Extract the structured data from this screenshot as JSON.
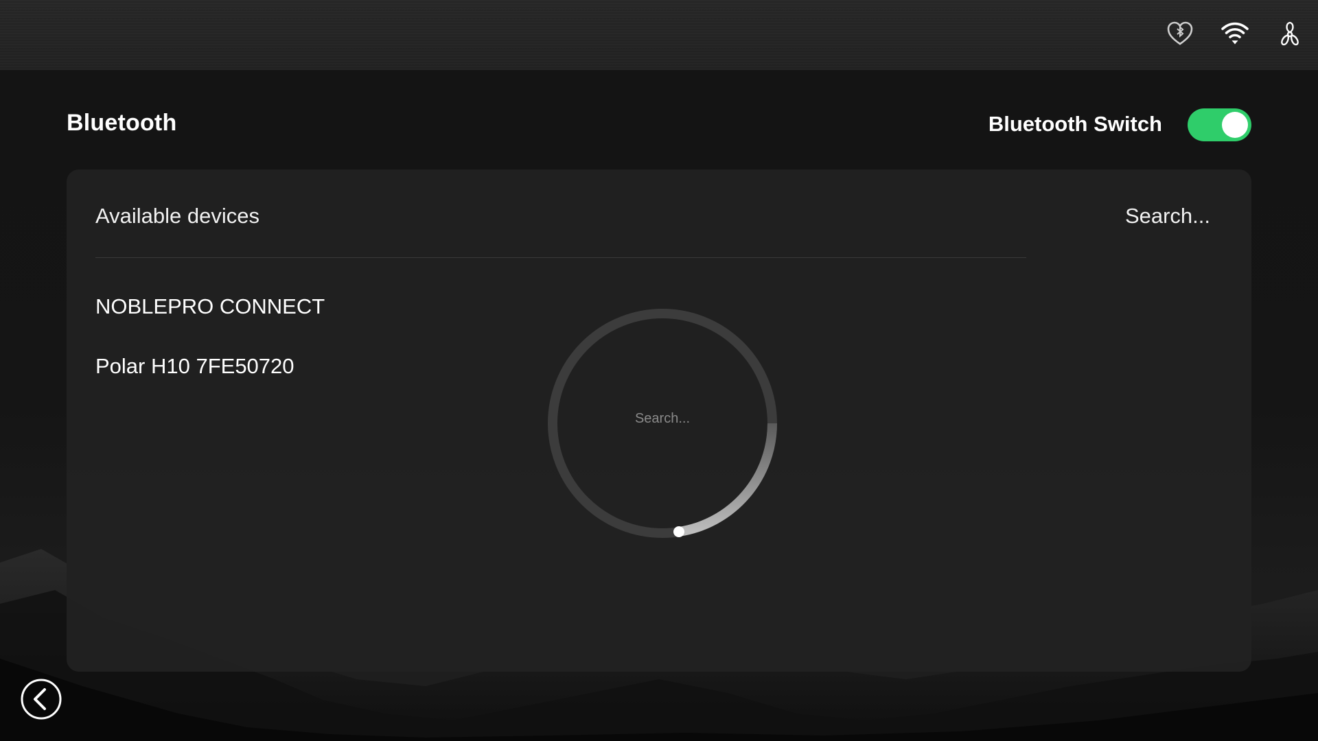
{
  "header": {
    "title": "Bluetooth",
    "switch_label": "Bluetooth Switch",
    "switch_on": true,
    "switch_color": "#2fcd6a"
  },
  "status_bar": {
    "icons": [
      "heart-bluetooth-icon",
      "wifi-icon",
      "fan-icon"
    ]
  },
  "devices_panel": {
    "heading": "Available devices",
    "search_label": "Search...",
    "devices": [
      {
        "name": "NOBLEPRO CONNECT"
      },
      {
        "name": "Polar H10 7FE50720"
      }
    ]
  },
  "spinner": {
    "label": "Search..."
  },
  "navigation": {
    "back_icon": "chevron-left-icon"
  }
}
